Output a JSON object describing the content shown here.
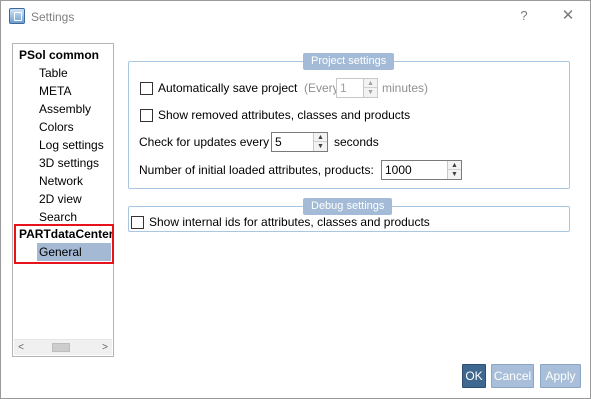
{
  "window": {
    "title": "Settings",
    "help": "?",
    "close": "✕"
  },
  "tree": {
    "items": [
      {
        "label": "PSol common",
        "level": 0
      },
      {
        "label": "Table",
        "level": 1
      },
      {
        "label": "META",
        "level": 1
      },
      {
        "label": "Assembly",
        "level": 1
      },
      {
        "label": "Colors",
        "level": 1
      },
      {
        "label": "Log settings",
        "level": 1
      },
      {
        "label": "3D settings",
        "level": 1
      },
      {
        "label": "Network",
        "level": 1
      },
      {
        "label": "2D view",
        "level": 1
      },
      {
        "label": "Search",
        "level": 1
      },
      {
        "label": "PARTdataCenter",
        "level": 0
      },
      {
        "label": "General",
        "level": 1,
        "selected": true
      }
    ],
    "scroll_left": "<",
    "scroll_right": ">"
  },
  "project_settings": {
    "title": "Project settings",
    "auto_save": {
      "label": "Automatically save project",
      "checked": false,
      "every_prefix": "(Every",
      "every_value": "1",
      "every_suffix": "minutes)"
    },
    "show_removed": {
      "label": "Show removed attributes, classes and products",
      "checked": false
    },
    "check_updates": {
      "label": "Check for updates every",
      "value": "5",
      "unit": "seconds"
    },
    "initial_loaded": {
      "label": "Number of initial loaded attributes, products:",
      "value": "1000"
    }
  },
  "debug_settings": {
    "title": "Debug settings",
    "show_internal_ids": {
      "label": "Show internal ids for attributes, classes and products",
      "checked": false
    }
  },
  "buttons": {
    "ok": "OK",
    "cancel": "Cancel",
    "apply": "Apply"
  },
  "colors": {
    "accent": "#3f6890",
    "group_title_bg": "#a4bbd7",
    "highlight": "#e8121a",
    "selection": "#a4b9d3"
  }
}
